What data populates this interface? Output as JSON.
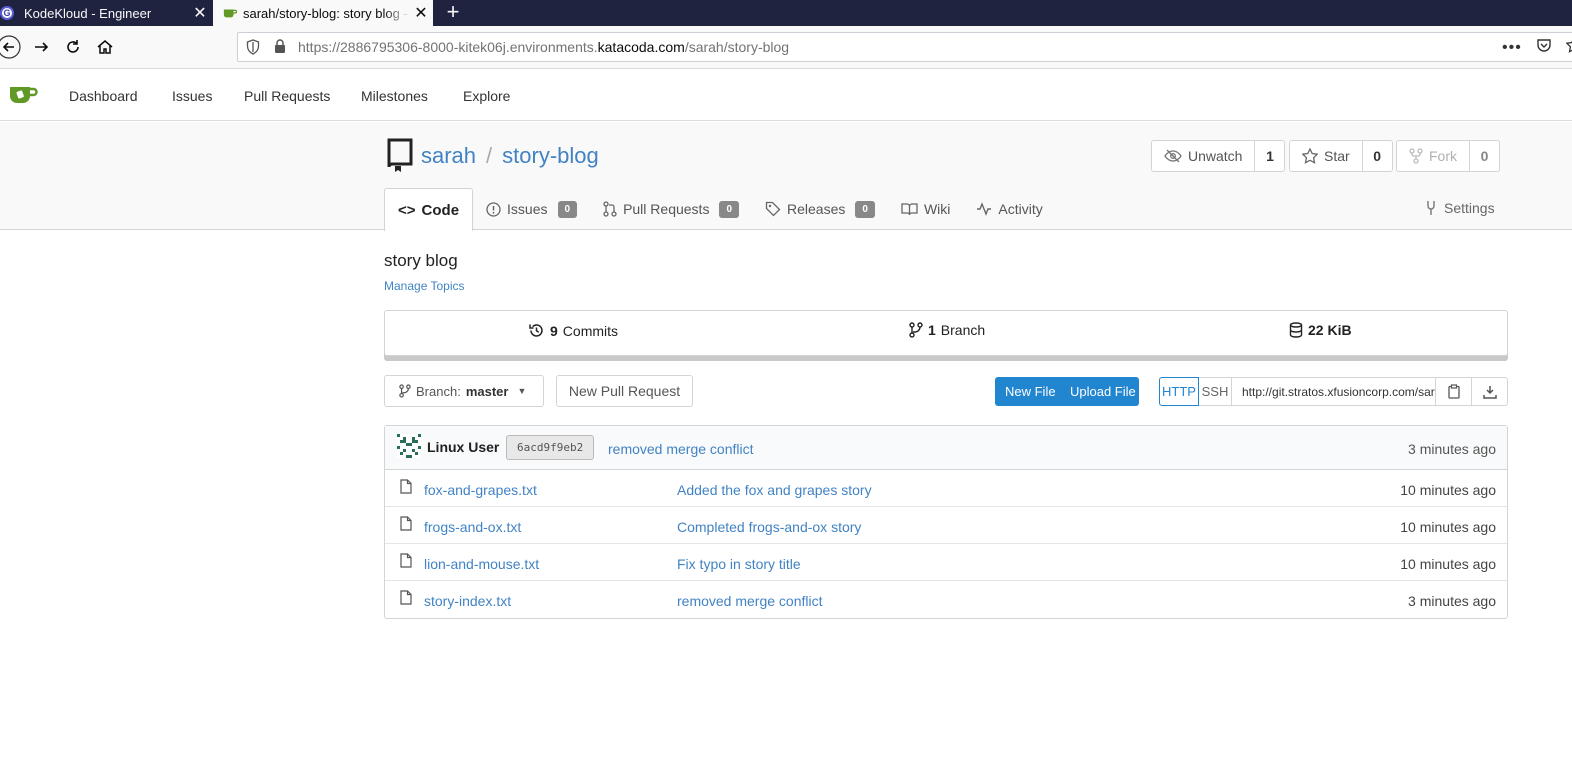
{
  "browser": {
    "tabs": [
      {
        "title": "KodeKloud - Engineer",
        "active": false,
        "favicon": "kodekloud-icon"
      },
      {
        "title": "sarah/story-blog: story blog - st",
        "active": true,
        "favicon": "gitea-icon"
      }
    ],
    "url": {
      "prefix": "https://2886795306-8000-kitek06j.environments.",
      "host": "katacoda.com",
      "path": "/sarah/story-blog"
    }
  },
  "header": {
    "menu": [
      "Dashboard",
      "Issues",
      "Pull Requests",
      "Milestones",
      "Explore"
    ]
  },
  "repo": {
    "owner": "sarah",
    "separator": "/",
    "name": "story-blog",
    "actions": {
      "watch_label": "Unwatch",
      "watch_count": "1",
      "star_label": "Star",
      "star_count": "0",
      "fork_label": "Fork",
      "fork_count": "0"
    },
    "tabs": {
      "code": "Code",
      "issues": "Issues",
      "issues_count": "0",
      "pulls": "Pull Requests",
      "pulls_count": "0",
      "releases": "Releases",
      "releases_count": "0",
      "wiki": "Wiki",
      "activity": "Activity",
      "settings": "Settings"
    },
    "description": "story blog",
    "manage_topics": "Manage Topics",
    "stats": {
      "commits_num": "9",
      "commits_label": "Commits",
      "branches_num": "1",
      "branches_label": "Branch",
      "size": "22 KiB"
    }
  },
  "toolbar": {
    "branch_prefix": "Branch:",
    "branch_name": "master",
    "new_pr": "New Pull Request",
    "new_file": "New File",
    "upload_file": "Upload File",
    "http": "HTTP",
    "ssh": "SSH",
    "clone_url": "http://git.stratos.xfusioncorp.com/sarah/story-blog.git"
  },
  "latest_commit": {
    "author": "Linux User",
    "sha": "6acd9f9eb2",
    "message": "removed merge conflict",
    "age": "3 minutes ago"
  },
  "files": [
    {
      "name": "fox-and-grapes.txt",
      "message": "Added the fox and grapes story",
      "age": "10 minutes ago"
    },
    {
      "name": "frogs-and-ox.txt",
      "message": "Completed frogs-and-ox story",
      "age": "10 minutes ago"
    },
    {
      "name": "lion-and-mouse.txt",
      "message": "Fix typo in story title",
      "age": "10 minutes ago"
    },
    {
      "name": "story-index.txt",
      "message": "removed merge conflict",
      "age": "3 minutes ago"
    }
  ],
  "colors": {
    "link": "#4183c4",
    "primary": "#2185d0",
    "tabbar": "#202340",
    "gitea_green": "#609926"
  }
}
